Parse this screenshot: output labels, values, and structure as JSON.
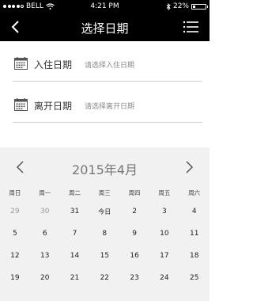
{
  "status_bar": {
    "carrier": "BELL",
    "time": "4:21 PM",
    "battery_percent": "22%",
    "battery_level": 0.22,
    "icons": [
      "signal-dots-icon",
      "wifi-icon",
      "bluetooth-icon",
      "battery-icon"
    ]
  },
  "nav": {
    "title": "选择日期",
    "icons": [
      "back-chevron-icon",
      "menu-icon"
    ]
  },
  "form": {
    "check_in": {
      "label": "入住日期",
      "placeholder": "请选择入住日期",
      "icon": "calendar-icon"
    },
    "check_out": {
      "label": "离开日期",
      "placeholder": "请选择离开日期",
      "icon": "calendar-icon"
    }
  },
  "calendar": {
    "title": "2015年4月",
    "prev_icon": "chevron-left-icon",
    "next_icon": "chevron-right-icon",
    "weekdays": [
      "周日",
      "周一",
      "周二",
      "周三",
      "周四",
      "周五",
      "周六"
    ],
    "weeks": [
      [
        "29",
        "30",
        "31",
        "今日",
        "2",
        "3",
        "4"
      ],
      [
        "5",
        "6",
        "7",
        "8",
        "9",
        "10",
        "11"
      ],
      [
        "12",
        "13",
        "14",
        "15",
        "16",
        "17",
        "18"
      ],
      [
        "19",
        "20",
        "21",
        "22",
        "23",
        "24",
        "25"
      ]
    ],
    "muted_days": [
      "29",
      "30"
    ]
  },
  "colors": {
    "header_bg": "#000000",
    "calendar_bg": "#f1f1f1",
    "divider": "#d0d0d0",
    "placeholder_text": "#888888"
  }
}
